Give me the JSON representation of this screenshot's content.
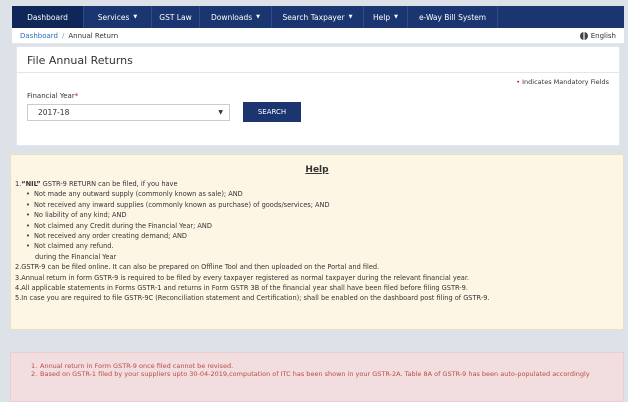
{
  "nav": {
    "items": [
      {
        "label": "Dashboard",
        "caret": false
      },
      {
        "label": "Services",
        "caret": true
      },
      {
        "label": "GST Law",
        "caret": false
      },
      {
        "label": "Downloads",
        "caret": true
      },
      {
        "label": "Search Taxpayer",
        "caret": true
      },
      {
        "label": "Help",
        "caret": true
      },
      {
        "label": "e-Way Bill System",
        "caret": false
      }
    ]
  },
  "breadcrumb": {
    "home": "Dashboard",
    "sep": "/",
    "current": "Annual Return"
  },
  "language": "English",
  "form": {
    "title": "File Annual Returns",
    "mandatory_star": "•",
    "mandatory_text": "Indicates Mandatory Fields",
    "fy_label": "Financial Year",
    "fy_required": "*",
    "fy_value": "2017-18",
    "search_label": "SEARCH"
  },
  "help": {
    "title": "Help",
    "p1_prefix": "1.",
    "p1_bold": "“NIL”",
    "p1_rest": " GSTR-9 RETURN can be filed, if you have",
    "bullets": [
      "Not made any outward supply (commonly known as sale); AND",
      "Not received any inward supplies (commonly known as purchase) of goods/services; AND",
      "No liability of any kind; AND",
      "Not claimed any Credit during the Financial Year; AND",
      "Not received any order creating demand; AND",
      "Not claimed any refund."
    ],
    "bullet_tail": "during the Financial Year",
    "p2": "2.GSTR-9 can be filed online. It can also be prepared on Offline Tool and then uploaded on the Portal and filed.",
    "p3": "3.Annual return in form GSTR-9 is required to be filed by every taxpayer registered as normal taxpayer during the relevant financial year.",
    "p4": "4.All applicable statements in Forms GSTR-1 and returns in Form GSTR 3B of the financial year shall have been filed before filing GSTR-9.",
    "p5": "5.In case you are required to file GSTR-9C (Reconciliation statement and Certification); shall be enabled on the dashboard post filing of GSTR-9."
  },
  "notice": {
    "items": [
      {
        "num": "1.",
        "text": "Annual return in Form GSTR-9 once filed cannot be revised."
      },
      {
        "num": "2.",
        "text": "Based on GSTR-1 filed by your suppliers upto 30-04-2019,computation of ITC has been shown in your GSTR-2A. Table 8A of GSTR-9 has been auto-populated accordingly"
      }
    ]
  }
}
